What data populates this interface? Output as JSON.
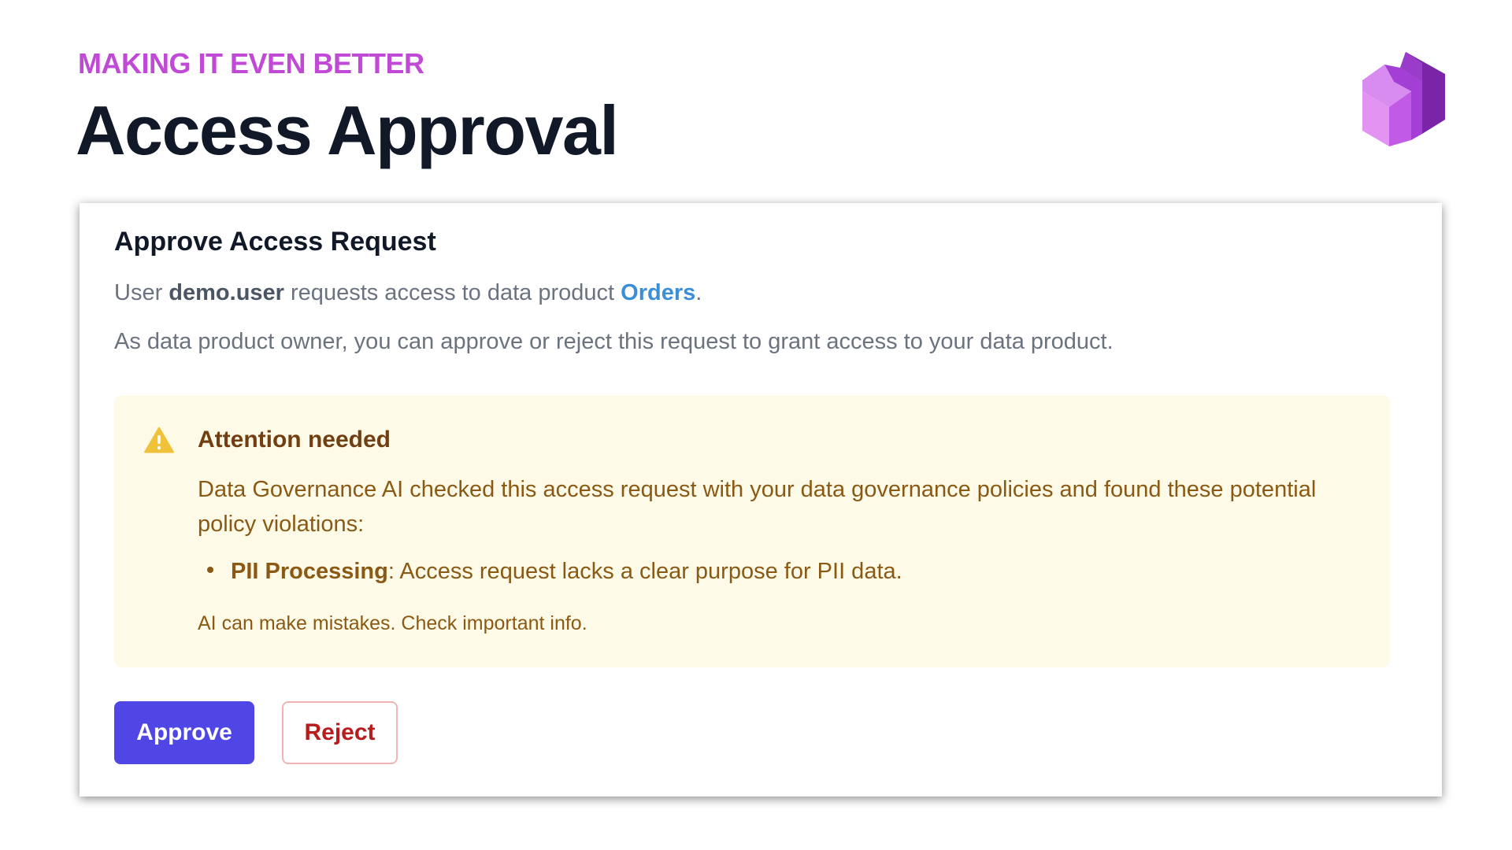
{
  "header": {
    "kicker": "MAKING IT EVEN BETTER",
    "title": "Access Approval",
    "logo_icon": "purple-cube-logo-icon"
  },
  "card": {
    "heading": "Approve Access Request",
    "request": {
      "prefix": "User ",
      "user": "demo.user",
      "middle": " requests access to data product ",
      "product": "Orders",
      "suffix": "."
    },
    "description": "As data product owner, you can approve or reject this request to grant access to your data product."
  },
  "alert": {
    "icon": "warning-triangle-icon",
    "title": "Attention needed",
    "body": "Data Governance AI checked this access request with your data governance policies and found these potential policy violations:",
    "violations": [
      {
        "term": "PII Processing",
        "text": ": Access request lacks a clear purpose for PII data."
      }
    ],
    "disclaimer": "AI can make mistakes. Check important info."
  },
  "actions": {
    "approve_label": "Approve",
    "reject_label": "Reject"
  },
  "colors": {
    "kicker": "#c04ad6",
    "title": "#111827",
    "link": "#3b8fd8",
    "alert_bg": "#fefae8",
    "alert_text": "#8a5a14",
    "alert_icon": "#f0c23a",
    "approve_bg": "#4f46e5",
    "reject_text": "#b91c1c",
    "reject_border": "#f0b4b4"
  }
}
